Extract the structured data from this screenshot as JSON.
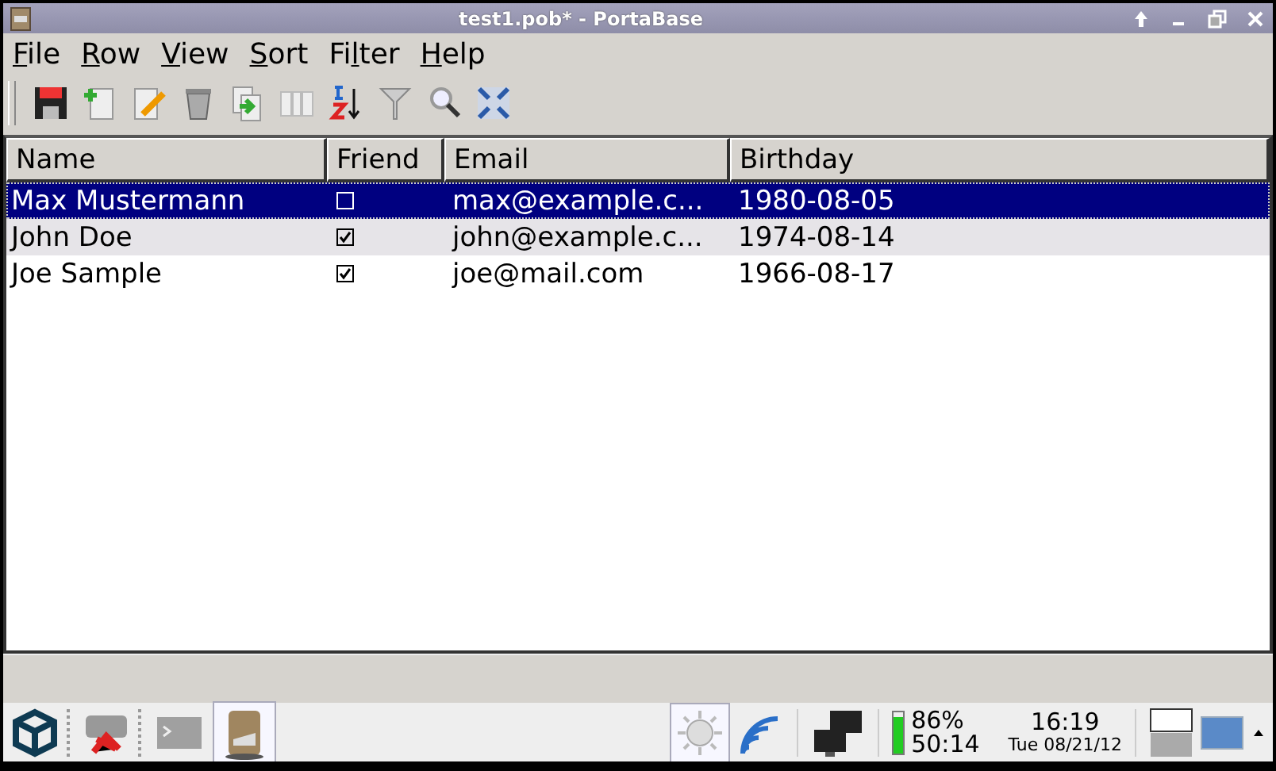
{
  "window": {
    "title": "test1.pob* - PortaBase"
  },
  "menu": [
    {
      "key": "F",
      "rest": "ile"
    },
    {
      "key": "R",
      "rest": "ow"
    },
    {
      "key": "V",
      "rest": "iew"
    },
    {
      "key": "S",
      "rest": "ort"
    },
    {
      "lead": "Fi",
      "key": "l",
      "rest": "ter"
    },
    {
      "key": "H",
      "rest": "elp"
    }
  ],
  "table": {
    "columns": [
      "Name",
      "Friend",
      "Email",
      "Birthday"
    ],
    "rows": [
      {
        "name": "Max Mustermann",
        "friend": false,
        "email": "max@example.c...",
        "birthday": "1980-08-05",
        "selected": true
      },
      {
        "name": "John Doe",
        "friend": true,
        "email": "john@example.c...",
        "birthday": "1974-08-14",
        "selected": false
      },
      {
        "name": "Joe Sample",
        "friend": true,
        "email": "joe@mail.com",
        "birthday": "1966-08-17",
        "selected": false
      }
    ]
  },
  "taskbar": {
    "battery": {
      "level": 0.86,
      "percent": "86%",
      "remaining": "50:14"
    },
    "clock": {
      "time": "16:19",
      "date": "Tue 08/21/12"
    }
  }
}
